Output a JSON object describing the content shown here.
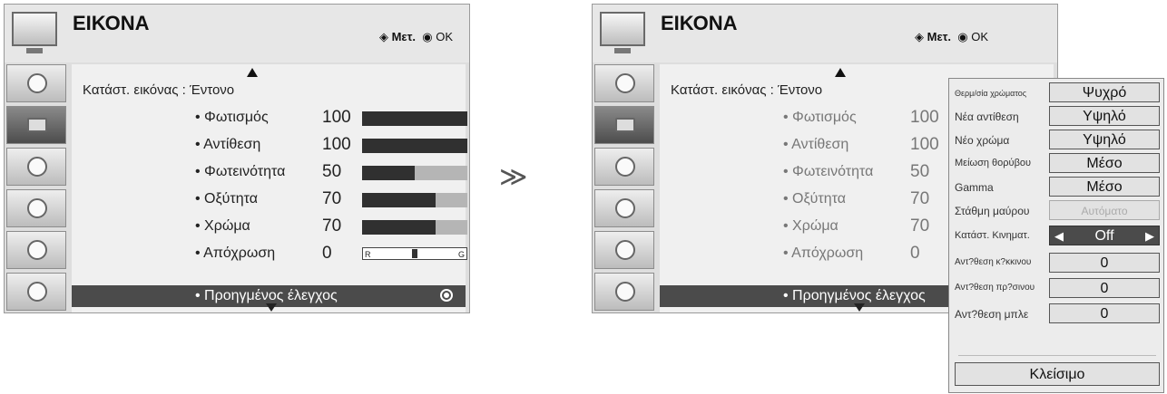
{
  "header": {
    "title": "ΕΙΚΟΝΑ",
    "nav_move": "Μετ.",
    "nav_ok": "OK"
  },
  "picture_mode": "Κατάστ. εικόνας : Έντονο",
  "settings": [
    {
      "label": "Φωτισμός",
      "value": "100",
      "level": 1.0
    },
    {
      "label": "Αντίθεση",
      "value": "100",
      "level": 1.0
    },
    {
      "label": "Φωτεινότητα",
      "value": "50",
      "level": 0.5
    },
    {
      "label": "Οξύτητα",
      "value": "70",
      "level": 0.7
    },
    {
      "label": "Χρώμα",
      "value": "70",
      "level": 0.7
    },
    {
      "label": "Απόχρωση",
      "value": "0",
      "tint_left": "R",
      "tint_right": "G"
    }
  ],
  "advanced": "Προηγμένος έλεγχος",
  "transition_arrow": "≫",
  "advanced_popup": {
    "items": [
      {
        "label": "Θερμ/σία χρώματος",
        "value": "Ψυχρό"
      },
      {
        "label": "Νέα αντίθεση",
        "value": "Υψηλό"
      },
      {
        "label": "Νέο χρώμα",
        "value": "Υψηλό"
      },
      {
        "label": "Μείωση θορύβου",
        "value": "Μέσο"
      },
      {
        "label": "Gamma",
        "value": "Μέσο"
      },
      {
        "label": "Στάθμη μαύρου",
        "value": "Αυτόματο"
      },
      {
        "label": "Κατάστ. Κινηματ.",
        "value": "Off"
      },
      {
        "label": "Αντ?θεση κ?κκινου",
        "value": "0"
      },
      {
        "label": "Αντ?θεση πρ?σινου",
        "value": "0"
      },
      {
        "label": "Αντ?θεση μπλε",
        "value": "0"
      }
    ],
    "close": "Κλείσιμο"
  }
}
